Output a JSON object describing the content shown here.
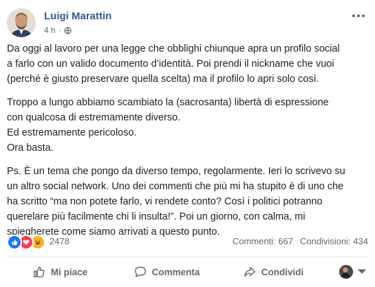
{
  "post": {
    "author": "Luigi Marattin",
    "time": "4 h",
    "separator": "·",
    "paragraphs": [
      [
        "Da oggi al lavoro per una legge che obblighi chiunque apra un profilo social",
        "a farlo con un valido documento d’identità. Poi prendi il nickname che vuoi",
        "(perché è giusto preservare quella scelta) ma il profilo lo apri solo così."
      ],
      [
        "Troppo a lungo abbiamo scambiato la (sacrosanta) libertà di espressione",
        "con qualcosa di estremamente diverso.",
        "Ed estremamente pericoloso.",
        "Ora basta."
      ],
      [
        "Ps. È un tema che pongo da diverso tempo, regolarmente. Ieri lo scrivevo su",
        "un altro social network. Uno dei commenti che più mi ha stupito è di uno che",
        "ha scritto “ma non potete farlo, vi rendete conto? Così i politici potranno",
        "querelare più facilmente chi li insulta!”. Poi un giorno, con calma, mi",
        "spiegherete come siamo arrivati a questo punto."
      ]
    ]
  },
  "reactions": {
    "count": "2478",
    "types": [
      "like",
      "love",
      "haha"
    ],
    "colors": {
      "like": "#1877f2",
      "love": "#f33e58",
      "haha": "#f7b125"
    }
  },
  "stats": {
    "comments": "Commenti: 667",
    "shares": "Condivisioni: 434"
  },
  "actions": {
    "like": "Mi piace",
    "comment": "Commenta",
    "share": "Condividi"
  },
  "colors": {
    "author": "#385898",
    "muted": "#606770"
  }
}
